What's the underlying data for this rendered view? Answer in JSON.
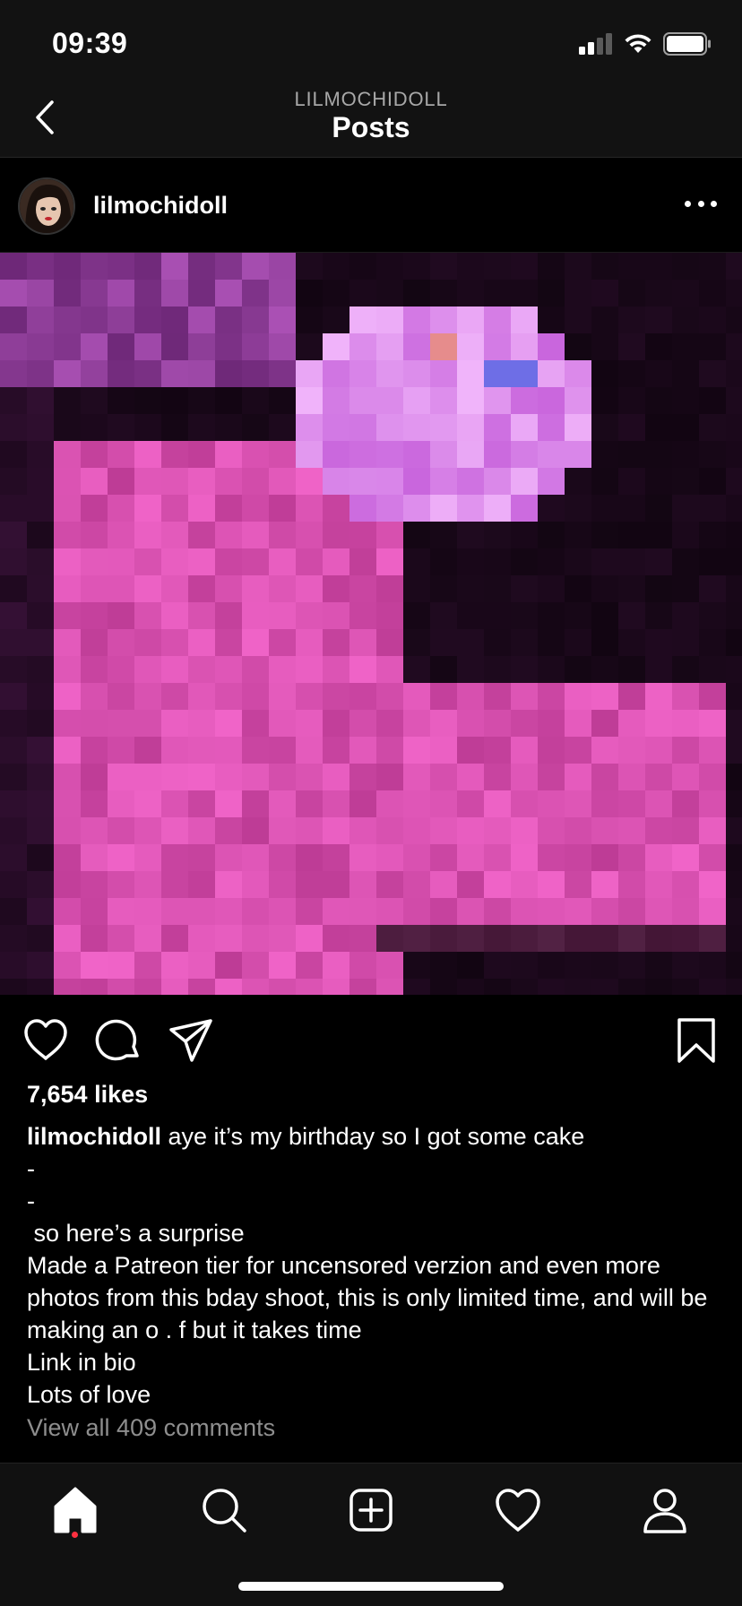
{
  "status_bar": {
    "time": "09:39"
  },
  "nav": {
    "subtitle": "LILMOCHIDOLL",
    "title": "Posts"
  },
  "post": {
    "username": "lilmochidoll",
    "likes": "7,654 likes",
    "caption": {
      "username": "lilmochidoll",
      "first_line": " aye it’s my birthday so I got some cake",
      "lines": [
        "-",
        "-",
        " so here’s a surprise",
        "Made a Patreon tier for uncensored verzion and even more photos from this bday shoot, this is only limited time, and will be making an o . f but it takes time",
        "Link in bio",
        "Lots of love"
      ]
    },
    "view_comments": "View all 409 comments"
  },
  "icons": {
    "back": "chevron-left-icon",
    "more": "more-dots-icon",
    "like": "heart-icon",
    "comment": "comment-bubble-icon",
    "share": "paper-plane-icon",
    "save": "bookmark-icon",
    "tabs": [
      "home-icon",
      "search-icon",
      "add-post-icon",
      "activity-heart-icon",
      "profile-icon"
    ]
  },
  "colors": {
    "background": "#000000",
    "bars": "#121212",
    "muted_text": "#8e8e8e",
    "notification_dot": "#ff3040"
  }
}
